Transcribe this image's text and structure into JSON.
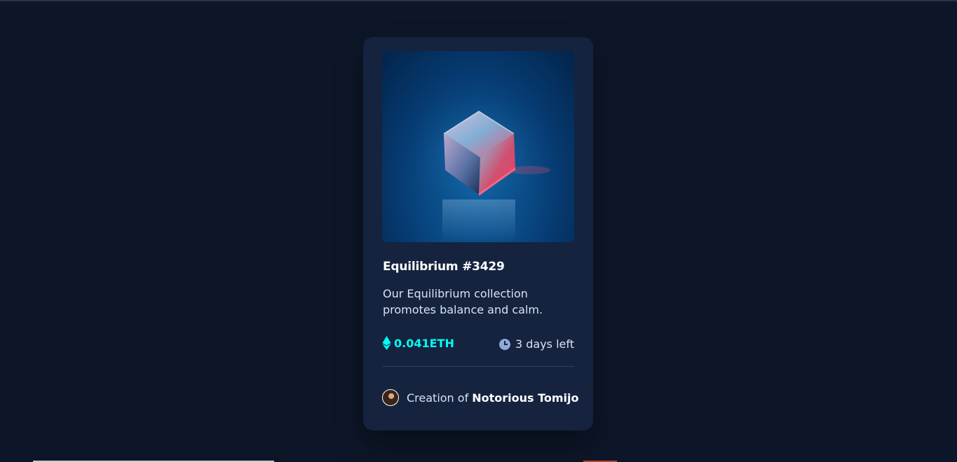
{
  "card": {
    "title": "Equilibrium #3429",
    "description": "Our Equilibrium collection promotes balance and calm.",
    "price": "0.041ETH",
    "time_left": "3 days left",
    "creator_prefix": "Creation of",
    "creator_name": "Notorious Tomijo"
  },
  "icons": {
    "price": "ethereum-icon",
    "timer": "clock-icon",
    "creator": "avatar"
  },
  "colors": {
    "background": "#0d1628",
    "card": "#15233e",
    "accent": "#00fff8",
    "text": "#d6e2f5"
  }
}
